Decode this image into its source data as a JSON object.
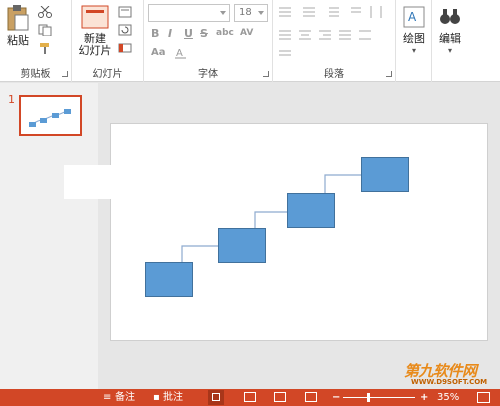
{
  "ribbon": {
    "clipboard": {
      "paste_label": "粘贴",
      "group_label": "剪贴板"
    },
    "slides": {
      "new_slide_label_line1": "新建",
      "new_slide_label_line2": "幻灯片",
      "group_label": "幻灯片"
    },
    "font": {
      "font_name": "",
      "font_size": "18",
      "group_label": "字体",
      "bold": "B",
      "italic": "I",
      "underline": "U",
      "strike": "S",
      "shadow": "abc",
      "spacing": "AV",
      "case": "Aa"
    },
    "paragraph": {
      "group_label": "段落"
    },
    "drawing": {
      "label": "绘图"
    },
    "editing": {
      "label": "编辑"
    }
  },
  "thumbnails": {
    "items": [
      {
        "number": "1"
      }
    ]
  },
  "status_bar": {
    "notes": "备注",
    "comments": "批注",
    "zoom_percent": "35%",
    "zoom_level_fraction": 0.35,
    "zoom_minus": "−",
    "zoom_plus": "+"
  },
  "watermark": {
    "text": "第九软件网",
    "sub": "WWW.D9SOFT.COM"
  },
  "colors": {
    "accent": "#d24726",
    "shape_fill": "#5b9bd5",
    "shape_border": "#41719c",
    "connector": "#8eaacf"
  }
}
